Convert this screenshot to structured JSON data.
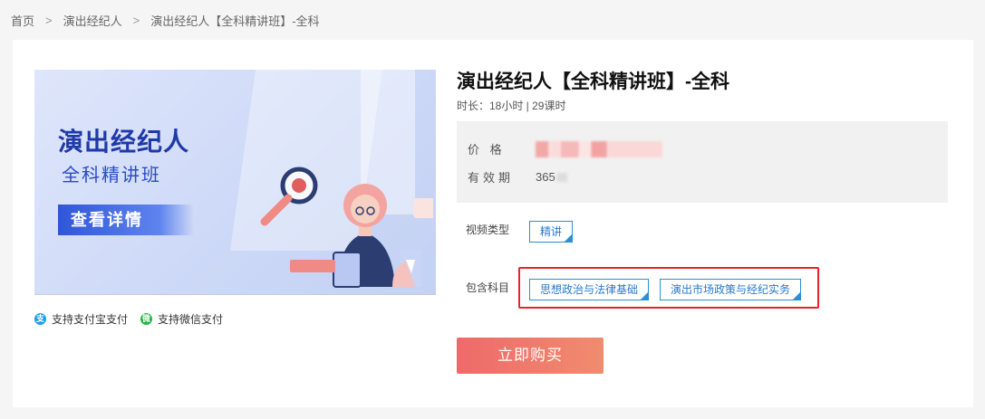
{
  "breadcrumb": {
    "home": "首页",
    "category": "演出经纪人",
    "current": "演出经纪人【全科精讲班】-全科",
    "separator": ">"
  },
  "banner": {
    "title": "演出经纪人",
    "subtitle": "全科精讲班",
    "cta": "查看详情"
  },
  "payment": {
    "alipay": "支持支付宝支付",
    "wechat": "支持微信支付"
  },
  "course": {
    "title": "演出经纪人【全科精讲班】-全科",
    "duration": "时长：18小时 | 29课时"
  },
  "price": {
    "price_label": "价 格",
    "validity_label": "有效期",
    "validity_value": "365"
  },
  "video_type": {
    "label": "视频类型",
    "value": "精讲"
  },
  "subjects": {
    "label": "包含科目",
    "items": [
      "思想政治与法律基础",
      "演出市场政策与经纪实务"
    ]
  },
  "buy_button": "立即购买",
  "colors": {
    "accent_blue": "#2a8fd4",
    "buy_gradient_start": "#ee6a6a",
    "buy_gradient_end": "#f08c6e",
    "highlight_red": "#e8212a"
  }
}
